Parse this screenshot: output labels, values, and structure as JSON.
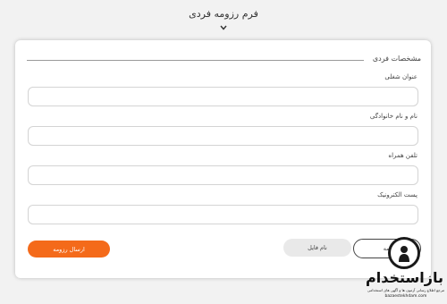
{
  "header": {
    "title": "فرم رزومه فردی",
    "chevron_icon": "chevron-down-icon"
  },
  "form": {
    "section_title": "مشخصات فردی",
    "fields": [
      {
        "label": "عنوان شغلی",
        "value": "",
        "placeholder": ""
      },
      {
        "label": "نام و نام خانوادگی",
        "value": "",
        "placeholder": ""
      },
      {
        "label": "تلفن همراه",
        "value": "",
        "placeholder": ""
      },
      {
        "label": "پست الکترونیک",
        "value": "",
        "placeholder": ""
      }
    ],
    "submit_label": "ارسال رزومه",
    "file_name_label": "نام فایل",
    "upload_label": "آپلود رزومه",
    "accent_color": "#f46a1a"
  },
  "watermark": {
    "name": "بازاستخدام",
    "tagline": "مرجع اطلاع رسانی آزمون ها و آگهی های استخدامی",
    "site": "bazaestekhdam.com",
    "icon": "person-search-icon"
  }
}
